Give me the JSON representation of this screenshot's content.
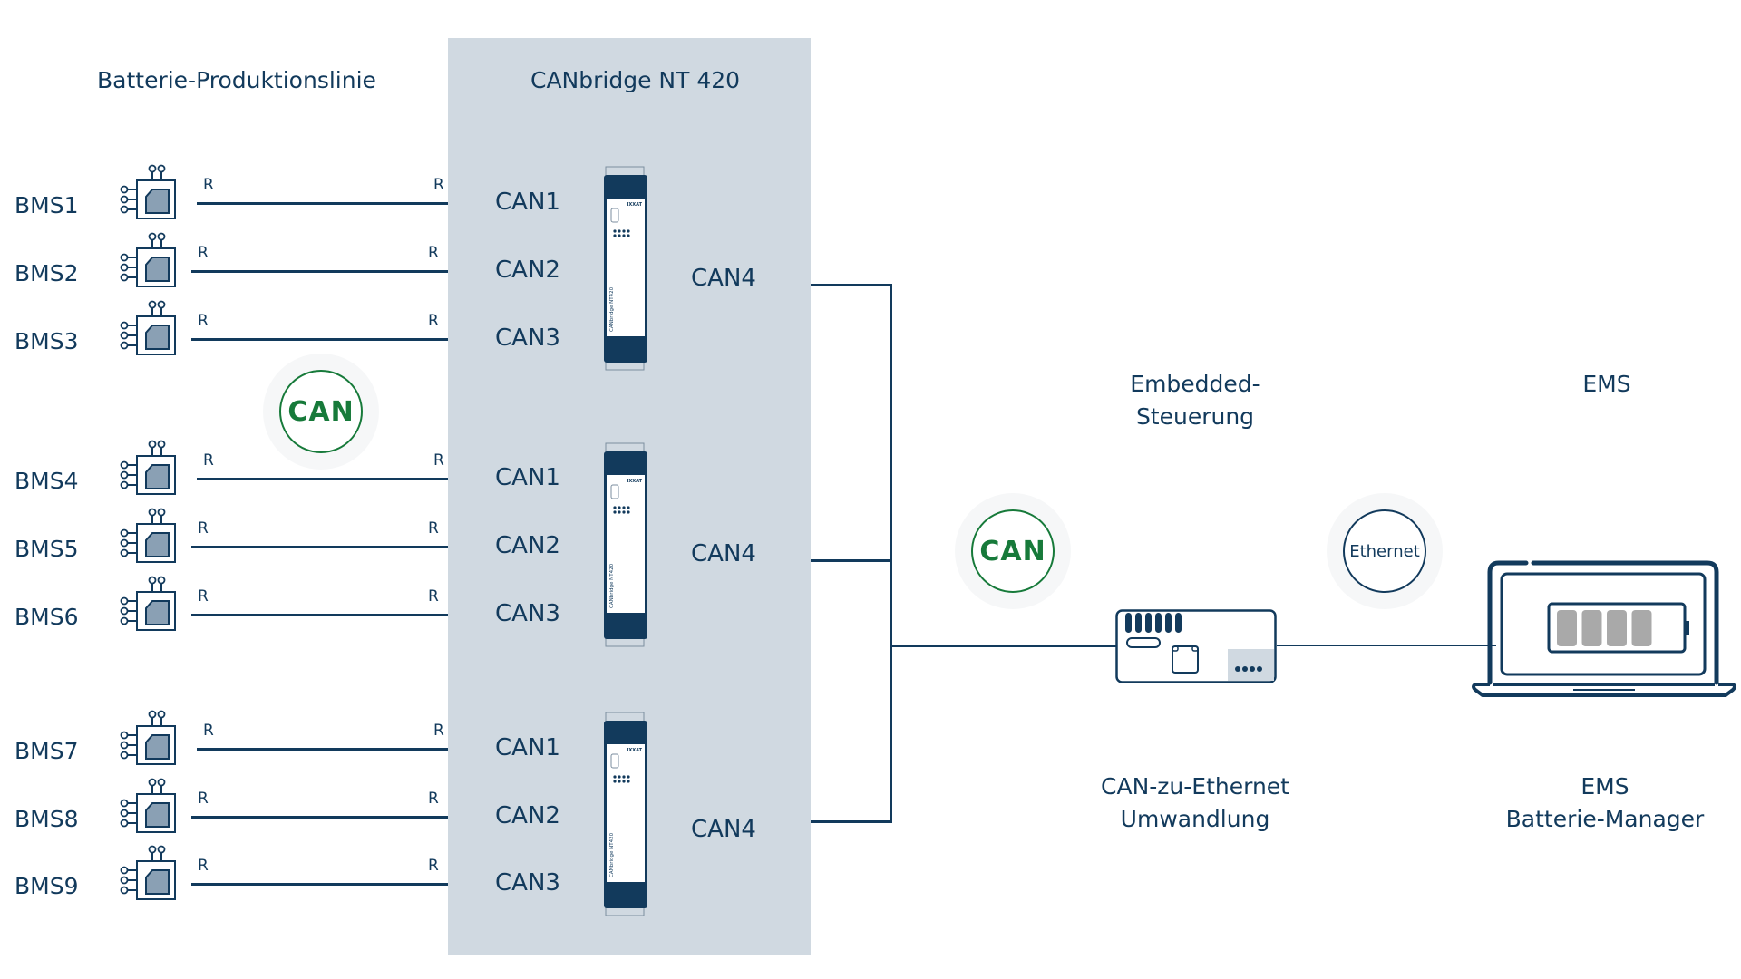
{
  "headings": {
    "production_line": "Batterie-Produktionslinie",
    "canbridge": "CANbridge NT 420"
  },
  "bms_units": [
    {
      "label": "BMS1",
      "r_left": "R",
      "r_right": "R",
      "port": "CAN1"
    },
    {
      "label": "BMS2",
      "r_left": "R",
      "r_right": "R",
      "port": "CAN2"
    },
    {
      "label": "BMS3",
      "r_left": "R",
      "r_right": "R",
      "port": "CAN3"
    },
    {
      "label": "BMS4",
      "r_left": "R",
      "r_right": "R",
      "port": "CAN1"
    },
    {
      "label": "BMS5",
      "r_left": "R",
      "r_right": "R",
      "port": "CAN2"
    },
    {
      "label": "BMS6",
      "r_left": "R",
      "r_right": "R",
      "port": "CAN3"
    },
    {
      "label": "BMS7",
      "r_left": "R",
      "r_right": "R",
      "port": "CAN1"
    },
    {
      "label": "BMS8",
      "r_left": "R",
      "r_right": "R",
      "port": "CAN2"
    },
    {
      "label": "BMS9",
      "r_left": "R",
      "r_right": "R",
      "port": "CAN3"
    }
  ],
  "bridges": [
    {
      "output_port": "CAN4",
      "brand": "IXXAT",
      "model_text": "CANbridge NT420"
    },
    {
      "output_port": "CAN4",
      "brand": "IXXAT",
      "model_text": "CANbridge NT420"
    },
    {
      "output_port": "CAN4",
      "brand": "IXXAT",
      "model_text": "CANbridge NT420"
    }
  ],
  "badges": {
    "can_left": "CAN",
    "can_right": "CAN",
    "ethernet": "Ethernet"
  },
  "embedded": {
    "title_line1": "Embedded-",
    "title_line2": "Steuerung",
    "caption_line1": "CAN-zu-Ethernet",
    "caption_line2": "Umwandlung"
  },
  "ems": {
    "title": "EMS",
    "caption_line1": "EMS",
    "caption_line2": "Batterie-Manager",
    "battery_filled_segments": 4,
    "battery_total_segments": 5
  },
  "colors": {
    "primary": "#123a5c",
    "panel": "#d0d9e1",
    "can_green": "#177a3a",
    "battery_gray": "#a9a9a9"
  }
}
